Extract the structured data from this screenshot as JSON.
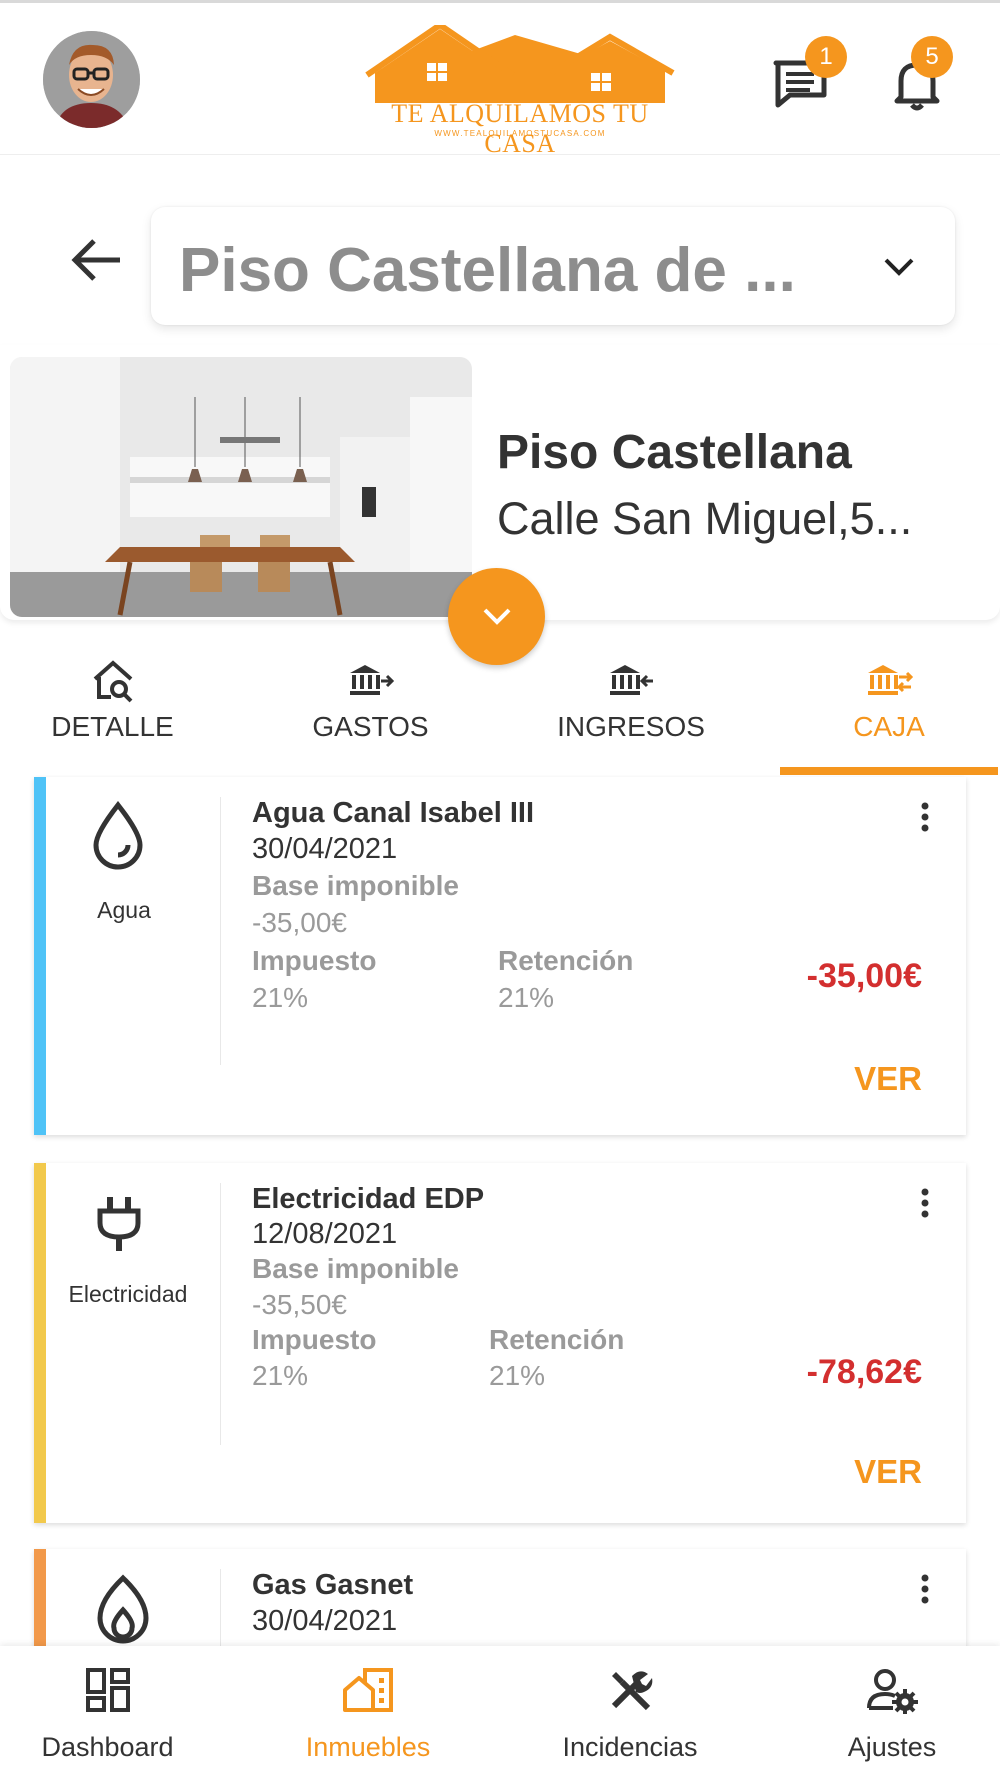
{
  "header": {
    "logo_text": "TE ALQUILAMOS TU CASA",
    "logo_url": "WWW.TEALQUILAMOSTUCASA.COM",
    "chat_badge": "1",
    "notifications_badge": "5"
  },
  "selector": {
    "value": "Piso Castellana de ..."
  },
  "property": {
    "name": "Piso Castellana",
    "address": "Calle San Miguel,5..."
  },
  "tabs": [
    {
      "label": "DETALLE",
      "icon": "house-search-icon"
    },
    {
      "label": "GASTOS",
      "icon": "bank-out-icon"
    },
    {
      "label": "INGRESOS",
      "icon": "bank-in-icon"
    },
    {
      "label": "CAJA",
      "icon": "bank-exchange-icon",
      "active": true
    }
  ],
  "cards": [
    {
      "category": "Agua",
      "category_icon": "water-drop-icon",
      "stripe_color": "#4fc3f7",
      "title": "Agua Canal Isabel III",
      "date": "30/04/2021",
      "base_label": "Base imponible",
      "base_value": "-35,00€",
      "tax_label": "Impuesto",
      "tax_value": "21%",
      "retention_label": "Retención",
      "retention_value": "21%",
      "amount": "-35,00€",
      "action": "VER"
    },
    {
      "category": "Electricidad",
      "category_icon": "plug-icon",
      "stripe_color": "#f2c94c",
      "title": "Electricidad EDP",
      "date": "12/08/2021",
      "base_label": "Base imponible",
      "base_value": "-35,50€",
      "tax_label": "Impuesto",
      "tax_value": "21%",
      "retention_label": "Retención",
      "retention_value": "21%",
      "amount": "-78,62€",
      "action": "VER"
    },
    {
      "category_icon": "flame-icon",
      "stripe_color": "#f2994a",
      "title": "Gas Gasnet",
      "date": "30/04/2021"
    }
  ],
  "bottom_nav": [
    {
      "label": "Dashboard",
      "icon": "dashboard-icon"
    },
    {
      "label": "Inmuebles",
      "icon": "buildings-icon",
      "active": true
    },
    {
      "label": "Incidencias",
      "icon": "tools-icon"
    },
    {
      "label": "Ajustes",
      "icon": "user-settings-icon"
    }
  ],
  "colors": {
    "accent": "#f5961e",
    "negative": "#d32f2f"
  }
}
